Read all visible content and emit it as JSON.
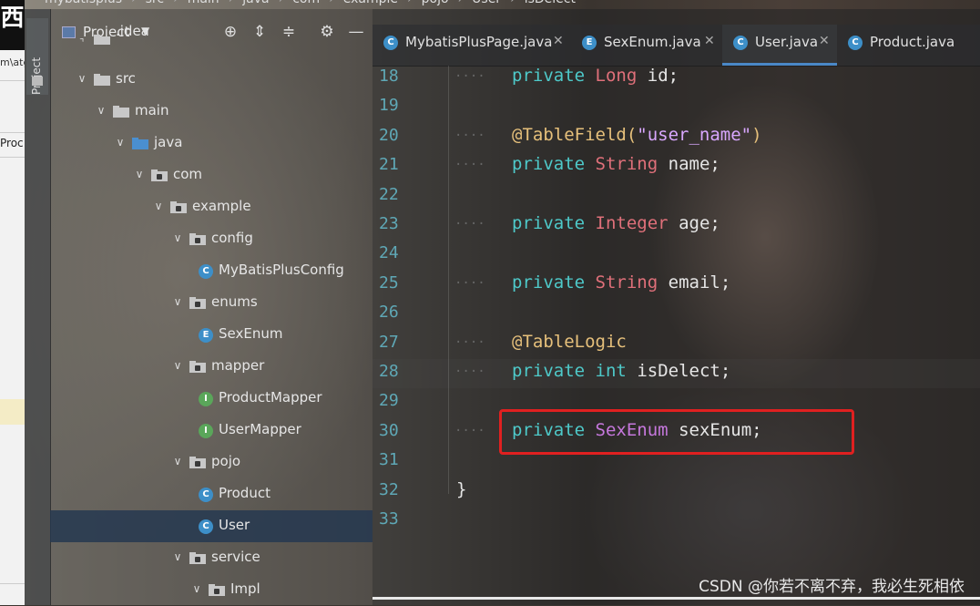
{
  "breadcrumb": [
    "mybatisplus",
    "src",
    "main",
    "java",
    "com",
    "example",
    "pojo",
    "User",
    "isDelect"
  ],
  "left_window": {
    "glyph": "西",
    "path_text": "m\\atg",
    "tab_text": "Proc"
  },
  "tool_strip": {
    "project_tab": "Project"
  },
  "project_panel": {
    "title": "Project",
    "toolbar_icons": [
      "locate-icon",
      "expand-all-icon",
      "collapse-all-icon",
      "settings-icon",
      "hide-icon"
    ],
    "tree": [
      {
        "label": ".idea",
        "kind": "folder",
        "depth": 2,
        "expanded": false
      },
      {
        "label": "src",
        "kind": "folder",
        "depth": 2,
        "expanded": true
      },
      {
        "label": "main",
        "kind": "folder",
        "depth": 3,
        "expanded": true
      },
      {
        "label": "java",
        "kind": "source-folder",
        "depth": 4,
        "expanded": true
      },
      {
        "label": "com",
        "kind": "package",
        "depth": 5,
        "expanded": true
      },
      {
        "label": "example",
        "kind": "package",
        "depth": 6,
        "expanded": true
      },
      {
        "label": "config",
        "kind": "package",
        "depth": 7,
        "expanded": true
      },
      {
        "label": "MyBatisPlusConfig",
        "kind": "class",
        "badge": "C",
        "depth": 8
      },
      {
        "label": "enums",
        "kind": "package",
        "depth": 7,
        "expanded": true
      },
      {
        "label": "SexEnum",
        "kind": "enum",
        "badge": "E",
        "depth": 8
      },
      {
        "label": "mapper",
        "kind": "package",
        "depth": 7,
        "expanded": true
      },
      {
        "label": "ProductMapper",
        "kind": "interface",
        "badge": "I",
        "depth": 8
      },
      {
        "label": "UserMapper",
        "kind": "interface",
        "badge": "I",
        "depth": 8
      },
      {
        "label": "pojo",
        "kind": "package",
        "depth": 7,
        "expanded": true
      },
      {
        "label": "Product",
        "kind": "class",
        "badge": "C",
        "depth": 8
      },
      {
        "label": "User",
        "kind": "class",
        "badge": "C",
        "depth": 8,
        "selected": true
      },
      {
        "label": "service",
        "kind": "package",
        "depth": 7,
        "expanded": true
      },
      {
        "label": "Impl",
        "kind": "package",
        "depth": 8,
        "expanded": true
      }
    ]
  },
  "editor": {
    "tabs": [
      {
        "label": "MybatisPlusPage.java",
        "badge": "C",
        "active": false
      },
      {
        "label": "SexEnum.java",
        "badge": "E",
        "active": false
      },
      {
        "label": "User.java",
        "badge": "C",
        "active": true
      },
      {
        "label": "Product.java",
        "badge": "C",
        "active": false
      }
    ],
    "lines": [
      {
        "num": "18",
        "tokens": [
          [
            "kw",
            "private"
          ],
          [
            "",
            ""
          ],
          [
            "type",
            "Long"
          ],
          [
            "",
            ""
          ],
          [
            "",
            "id;"
          ]
        ]
      },
      {
        "num": "19",
        "tokens": []
      },
      {
        "num": "20",
        "tokens": [
          [
            "ann",
            "@TableField("
          ],
          [
            "str",
            "\"user_name\""
          ],
          [
            "ann",
            ")"
          ]
        ]
      },
      {
        "num": "21",
        "tokens": [
          [
            "kw",
            "private"
          ],
          [
            "",
            ""
          ],
          [
            "type",
            "String"
          ],
          [
            "",
            ""
          ],
          [
            "",
            "name;"
          ]
        ]
      },
      {
        "num": "22",
        "tokens": []
      },
      {
        "num": "23",
        "tokens": [
          [
            "kw",
            "private"
          ],
          [
            "",
            ""
          ],
          [
            "type",
            "Integer"
          ],
          [
            "",
            ""
          ],
          [
            "",
            "age;"
          ]
        ]
      },
      {
        "num": "24",
        "tokens": []
      },
      {
        "num": "25",
        "tokens": [
          [
            "kw",
            "private"
          ],
          [
            "",
            ""
          ],
          [
            "type",
            "String"
          ],
          [
            "",
            ""
          ],
          [
            "",
            "email;"
          ]
        ]
      },
      {
        "num": "26",
        "tokens": []
      },
      {
        "num": "27",
        "tokens": [
          [
            "ann",
            "@TableLogic"
          ]
        ]
      },
      {
        "num": "28",
        "tokens": [
          [
            "kw",
            "private"
          ],
          [
            "",
            ""
          ],
          [
            "kw",
            "int"
          ],
          [
            "",
            ""
          ],
          [
            "",
            "isDelect;"
          ]
        ]
      },
      {
        "num": "29",
        "tokens": []
      },
      {
        "num": "30",
        "tokens": [
          [
            "kw",
            "private"
          ],
          [
            "",
            ""
          ],
          [
            "enumt",
            "SexEnum"
          ],
          [
            "",
            ""
          ],
          [
            "",
            "sexEnum;"
          ]
        ]
      },
      {
        "num": "31",
        "tokens": []
      },
      {
        "num": "32",
        "tokens": [
          [
            "",
            "}"
          ]
        ]
      },
      {
        "num": "33",
        "tokens": []
      }
    ]
  },
  "watermark": "CSDN @你若不离不弃，我必生死相依",
  "colors": {
    "keyword": "#4ec9c9",
    "type": "#e0707a",
    "annotation": "#e6c07b",
    "string": "#d9a7ff",
    "highlight_box": "#e02020",
    "selection": "#263850",
    "class_badge": "#3d8fc8",
    "enum_badge": "#3d8fc8",
    "interface_badge": "#5aa65a"
  }
}
